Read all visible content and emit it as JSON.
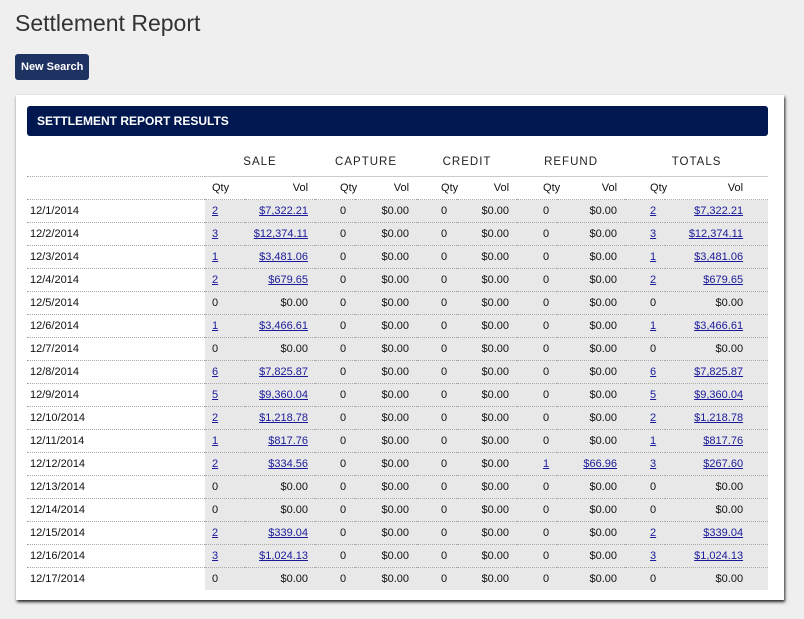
{
  "page": {
    "title": "Settlement Report",
    "new_search_label": "New Search"
  },
  "panel": {
    "header": "SETTLEMENT REPORT RESULTS"
  },
  "table": {
    "groups": [
      "SALE",
      "CAPTURE",
      "CREDIT",
      "REFUND",
      "TOTALS"
    ],
    "sub_headers": [
      "Qty",
      "Vol"
    ],
    "rows": [
      {
        "date": "12/1/2014",
        "sale": [
          "2",
          "$7,322.21"
        ],
        "capture": [
          "0",
          "$0.00"
        ],
        "credit": [
          "0",
          "$0.00"
        ],
        "refund": [
          "0",
          "$0.00"
        ],
        "totals": [
          "2",
          "$7,322.21"
        ]
      },
      {
        "date": "12/2/2014",
        "sale": [
          "3",
          "$12,374.11"
        ],
        "capture": [
          "0",
          "$0.00"
        ],
        "credit": [
          "0",
          "$0.00"
        ],
        "refund": [
          "0",
          "$0.00"
        ],
        "totals": [
          "3",
          "$12,374.11"
        ]
      },
      {
        "date": "12/3/2014",
        "sale": [
          "1",
          "$3,481.06"
        ],
        "capture": [
          "0",
          "$0.00"
        ],
        "credit": [
          "0",
          "$0.00"
        ],
        "refund": [
          "0",
          "$0.00"
        ],
        "totals": [
          "1",
          "$3,481.06"
        ]
      },
      {
        "date": "12/4/2014",
        "sale": [
          "2",
          "$679.65"
        ],
        "capture": [
          "0",
          "$0.00"
        ],
        "credit": [
          "0",
          "$0.00"
        ],
        "refund": [
          "0",
          "$0.00"
        ],
        "totals": [
          "2",
          "$679.65"
        ]
      },
      {
        "date": "12/5/2014",
        "sale": [
          "0",
          "$0.00"
        ],
        "capture": [
          "0",
          "$0.00"
        ],
        "credit": [
          "0",
          "$0.00"
        ],
        "refund": [
          "0",
          "$0.00"
        ],
        "totals": [
          "0",
          "$0.00"
        ]
      },
      {
        "date": "12/6/2014",
        "sale": [
          "1",
          "$3,466.61"
        ],
        "capture": [
          "0",
          "$0.00"
        ],
        "credit": [
          "0",
          "$0.00"
        ],
        "refund": [
          "0",
          "$0.00"
        ],
        "totals": [
          "1",
          "$3,466.61"
        ]
      },
      {
        "date": "12/7/2014",
        "sale": [
          "0",
          "$0.00"
        ],
        "capture": [
          "0",
          "$0.00"
        ],
        "credit": [
          "0",
          "$0.00"
        ],
        "refund": [
          "0",
          "$0.00"
        ],
        "totals": [
          "0",
          "$0.00"
        ]
      },
      {
        "date": "12/8/2014",
        "sale": [
          "6",
          "$7,825.87"
        ],
        "capture": [
          "0",
          "$0.00"
        ],
        "credit": [
          "0",
          "$0.00"
        ],
        "refund": [
          "0",
          "$0.00"
        ],
        "totals": [
          "6",
          "$7,825.87"
        ]
      },
      {
        "date": "12/9/2014",
        "sale": [
          "5",
          "$9,360.04"
        ],
        "capture": [
          "0",
          "$0.00"
        ],
        "credit": [
          "0",
          "$0.00"
        ],
        "refund": [
          "0",
          "$0.00"
        ],
        "totals": [
          "5",
          "$9,360.04"
        ]
      },
      {
        "date": "12/10/2014",
        "sale": [
          "2",
          "$1,218.78"
        ],
        "capture": [
          "0",
          "$0.00"
        ],
        "credit": [
          "0",
          "$0.00"
        ],
        "refund": [
          "0",
          "$0.00"
        ],
        "totals": [
          "2",
          "$1,218.78"
        ]
      },
      {
        "date": "12/11/2014",
        "sale": [
          "1",
          "$817.76"
        ],
        "capture": [
          "0",
          "$0.00"
        ],
        "credit": [
          "0",
          "$0.00"
        ],
        "refund": [
          "0",
          "$0.00"
        ],
        "totals": [
          "1",
          "$817.76"
        ]
      },
      {
        "date": "12/12/2014",
        "sale": [
          "2",
          "$334.56"
        ],
        "capture": [
          "0",
          "$0.00"
        ],
        "credit": [
          "0",
          "$0.00"
        ],
        "refund": [
          "1",
          "$66.96"
        ],
        "totals": [
          "3",
          "$267.60"
        ]
      },
      {
        "date": "12/13/2014",
        "sale": [
          "0",
          "$0.00"
        ],
        "capture": [
          "0",
          "$0.00"
        ],
        "credit": [
          "0",
          "$0.00"
        ],
        "refund": [
          "0",
          "$0.00"
        ],
        "totals": [
          "0",
          "$0.00"
        ]
      },
      {
        "date": "12/14/2014",
        "sale": [
          "0",
          "$0.00"
        ],
        "capture": [
          "0",
          "$0.00"
        ],
        "credit": [
          "0",
          "$0.00"
        ],
        "refund": [
          "0",
          "$0.00"
        ],
        "totals": [
          "0",
          "$0.00"
        ]
      },
      {
        "date": "12/15/2014",
        "sale": [
          "2",
          "$339.04"
        ],
        "capture": [
          "0",
          "$0.00"
        ],
        "credit": [
          "0",
          "$0.00"
        ],
        "refund": [
          "0",
          "$0.00"
        ],
        "totals": [
          "2",
          "$339.04"
        ]
      },
      {
        "date": "12/16/2014",
        "sale": [
          "3",
          "$1,024.13"
        ],
        "capture": [
          "0",
          "$0.00"
        ],
        "credit": [
          "0",
          "$0.00"
        ],
        "refund": [
          "0",
          "$0.00"
        ],
        "totals": [
          "3",
          "$1,024.13"
        ]
      },
      {
        "date": "12/17/2014",
        "sale": [
          "0",
          "$0.00"
        ],
        "capture": [
          "0",
          "$0.00"
        ],
        "credit": [
          "0",
          "$0.00"
        ],
        "refund": [
          "0",
          "$0.00"
        ],
        "totals": [
          "0",
          "$0.00"
        ]
      }
    ]
  },
  "colors": {
    "button": "#1f3363",
    "header_bar": "#00174f",
    "link": "#1a1a9a",
    "cell_bg": "#e8e8e8"
  }
}
